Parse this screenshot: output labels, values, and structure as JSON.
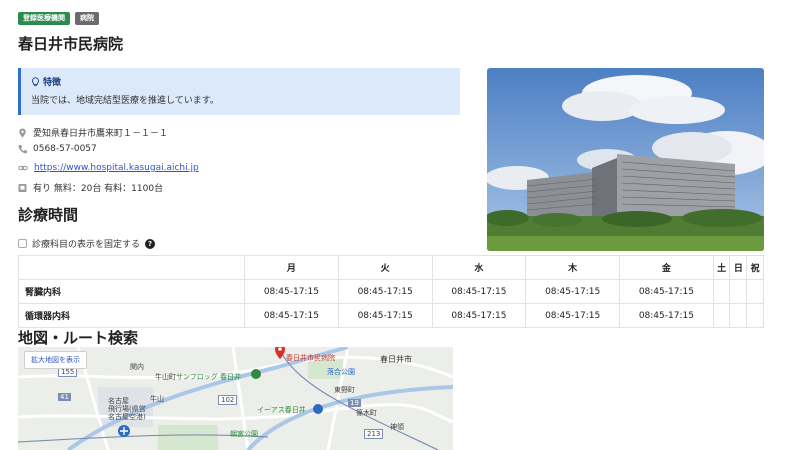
{
  "badges": [
    "登録医療機関",
    "病院"
  ],
  "hospital": {
    "name": "春日井市民病院"
  },
  "feature": {
    "title": "特徴",
    "text": "当院では、地域完結型医療を推進しています。"
  },
  "info": {
    "address": "愛知県春日井市鷹来町１－１－１",
    "phone": "0568-57-0057",
    "url": "https://www.hospital.kasugai.aichi.jp",
    "parking": "有り  無料：20台  有料：1100台"
  },
  "schedule": {
    "heading": "診療時間",
    "fix_label": "診療科目の表示を固定する",
    "help_symbol": "?",
    "days": [
      "月",
      "火",
      "水",
      "木",
      "金",
      "土",
      "日",
      "祝"
    ],
    "rows": [
      {
        "dept": "腎臓内科",
        "hours": [
          "08:45-17:15",
          "08:45-17:15",
          "08:45-17:15",
          "08:45-17:15",
          "08:45-17:15",
          "",
          "",
          ""
        ]
      },
      {
        "dept": "循環器内科",
        "hours": [
          "08:45-17:15",
          "08:45-17:15",
          "08:45-17:15",
          "08:45-17:15",
          "08:45-17:15",
          "",
          "",
          ""
        ]
      }
    ]
  },
  "map": {
    "heading": "地図・ルート検索",
    "enlarge_label": "拡大地図を表示",
    "labels": {
      "hospital": "春日井市民病院",
      "kasugai_city": "春日井市",
      "kanjo": "関内",
      "ushiyama_town": "牛山町",
      "sunflog": "サンフロッグ 春日井",
      "ochiai_park": "落合公園",
      "higashino": "東野町",
      "ushiyama": "牛山",
      "nagoya_airport": "名古屋\n飛行場(県営\n名古屋空港)",
      "aeon": "イーアス春日井",
      "shinoki": "篠木町",
      "shinmei": "神領",
      "asamiya_park": "朝宮公園",
      "route_155": "155",
      "route_41": "41",
      "route_102": "102",
      "route_19": "19",
      "route_213": "213"
    }
  }
}
